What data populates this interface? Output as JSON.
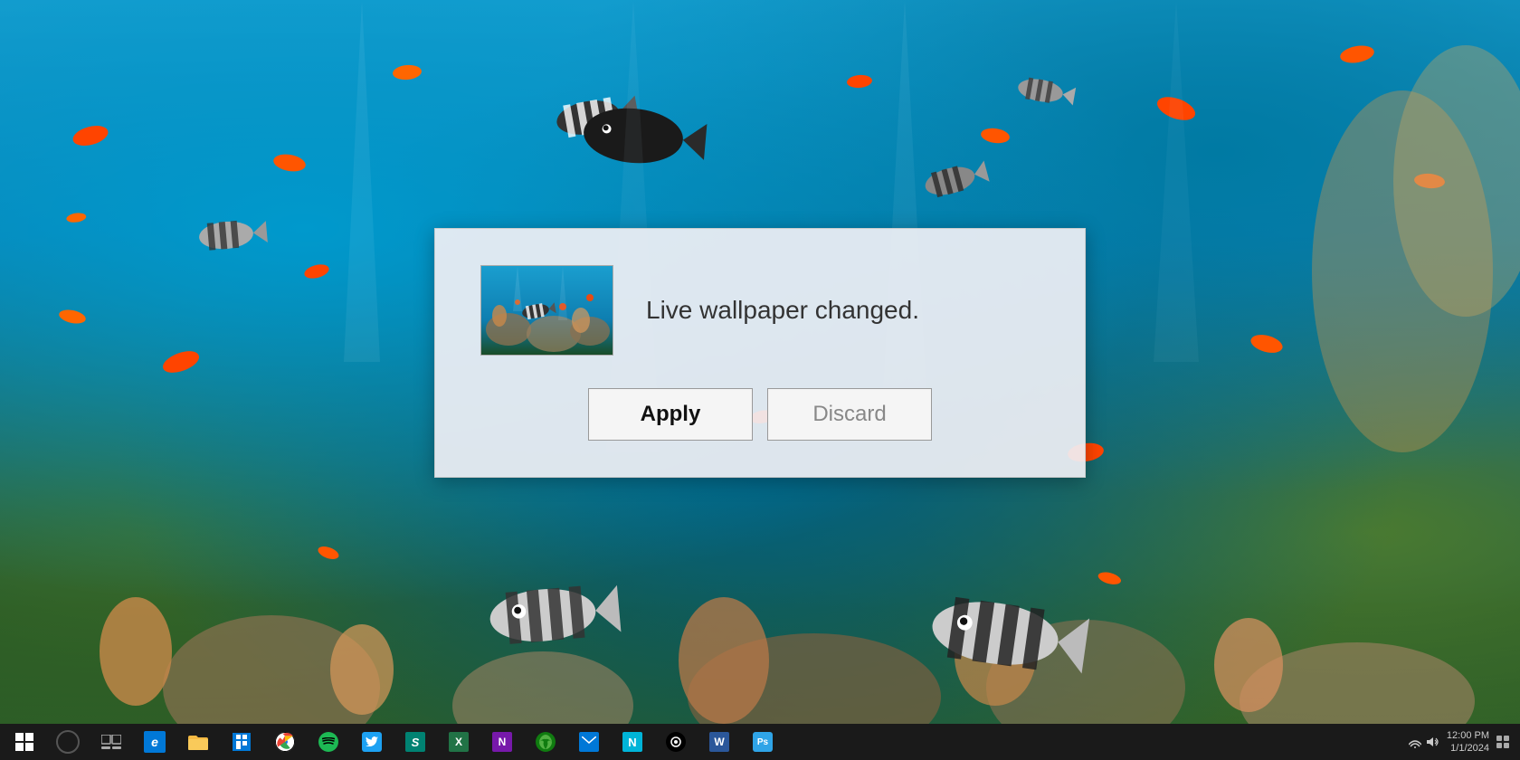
{
  "desktop": {
    "background_description": "Underwater coral reef with colorful fish"
  },
  "dialog": {
    "message": "Live wallpaper changed.",
    "thumbnail_alt": "Coral reef preview",
    "apply_label": "Apply",
    "discard_label": "Discard"
  },
  "taskbar": {
    "items": [
      {
        "name": "start-button",
        "label": "⊞",
        "icon_type": "windows"
      },
      {
        "name": "cortana-button",
        "label": "",
        "icon_type": "cortana"
      },
      {
        "name": "task-view-button",
        "label": "⧉",
        "icon_type": "taskview"
      },
      {
        "name": "edge-button",
        "label": "e",
        "icon_type": "edge"
      },
      {
        "name": "folder-button",
        "label": "📁",
        "icon_type": "folder"
      },
      {
        "name": "store-button",
        "label": "🛍",
        "icon_type": "store"
      },
      {
        "name": "chrome-button",
        "label": "⊙",
        "icon_type": "chrome"
      },
      {
        "name": "spotify-button",
        "label": "♪",
        "icon_type": "spotify"
      },
      {
        "name": "twitter-button",
        "label": "🐦",
        "icon_type": "twitter"
      },
      {
        "name": "sway-button",
        "label": "S",
        "icon_type": "sway"
      },
      {
        "name": "excel-button",
        "label": "X",
        "icon_type": "excel"
      },
      {
        "name": "onenote-button",
        "label": "N",
        "icon_type": "onenote"
      },
      {
        "name": "xbox-button",
        "label": "⬤",
        "icon_type": "xbox"
      },
      {
        "name": "mail-button",
        "label": "✉",
        "icon_type": "mail"
      },
      {
        "name": "note-button",
        "label": "N",
        "icon_type": "note"
      },
      {
        "name": "sonos-button",
        "label": "S",
        "icon_type": "sonos"
      },
      {
        "name": "word-button",
        "label": "W",
        "icon_type": "word"
      },
      {
        "name": "ps-button",
        "label": "Ps",
        "icon_type": "ps"
      }
    ],
    "time": "12:00",
    "date": "1/1/2024"
  }
}
